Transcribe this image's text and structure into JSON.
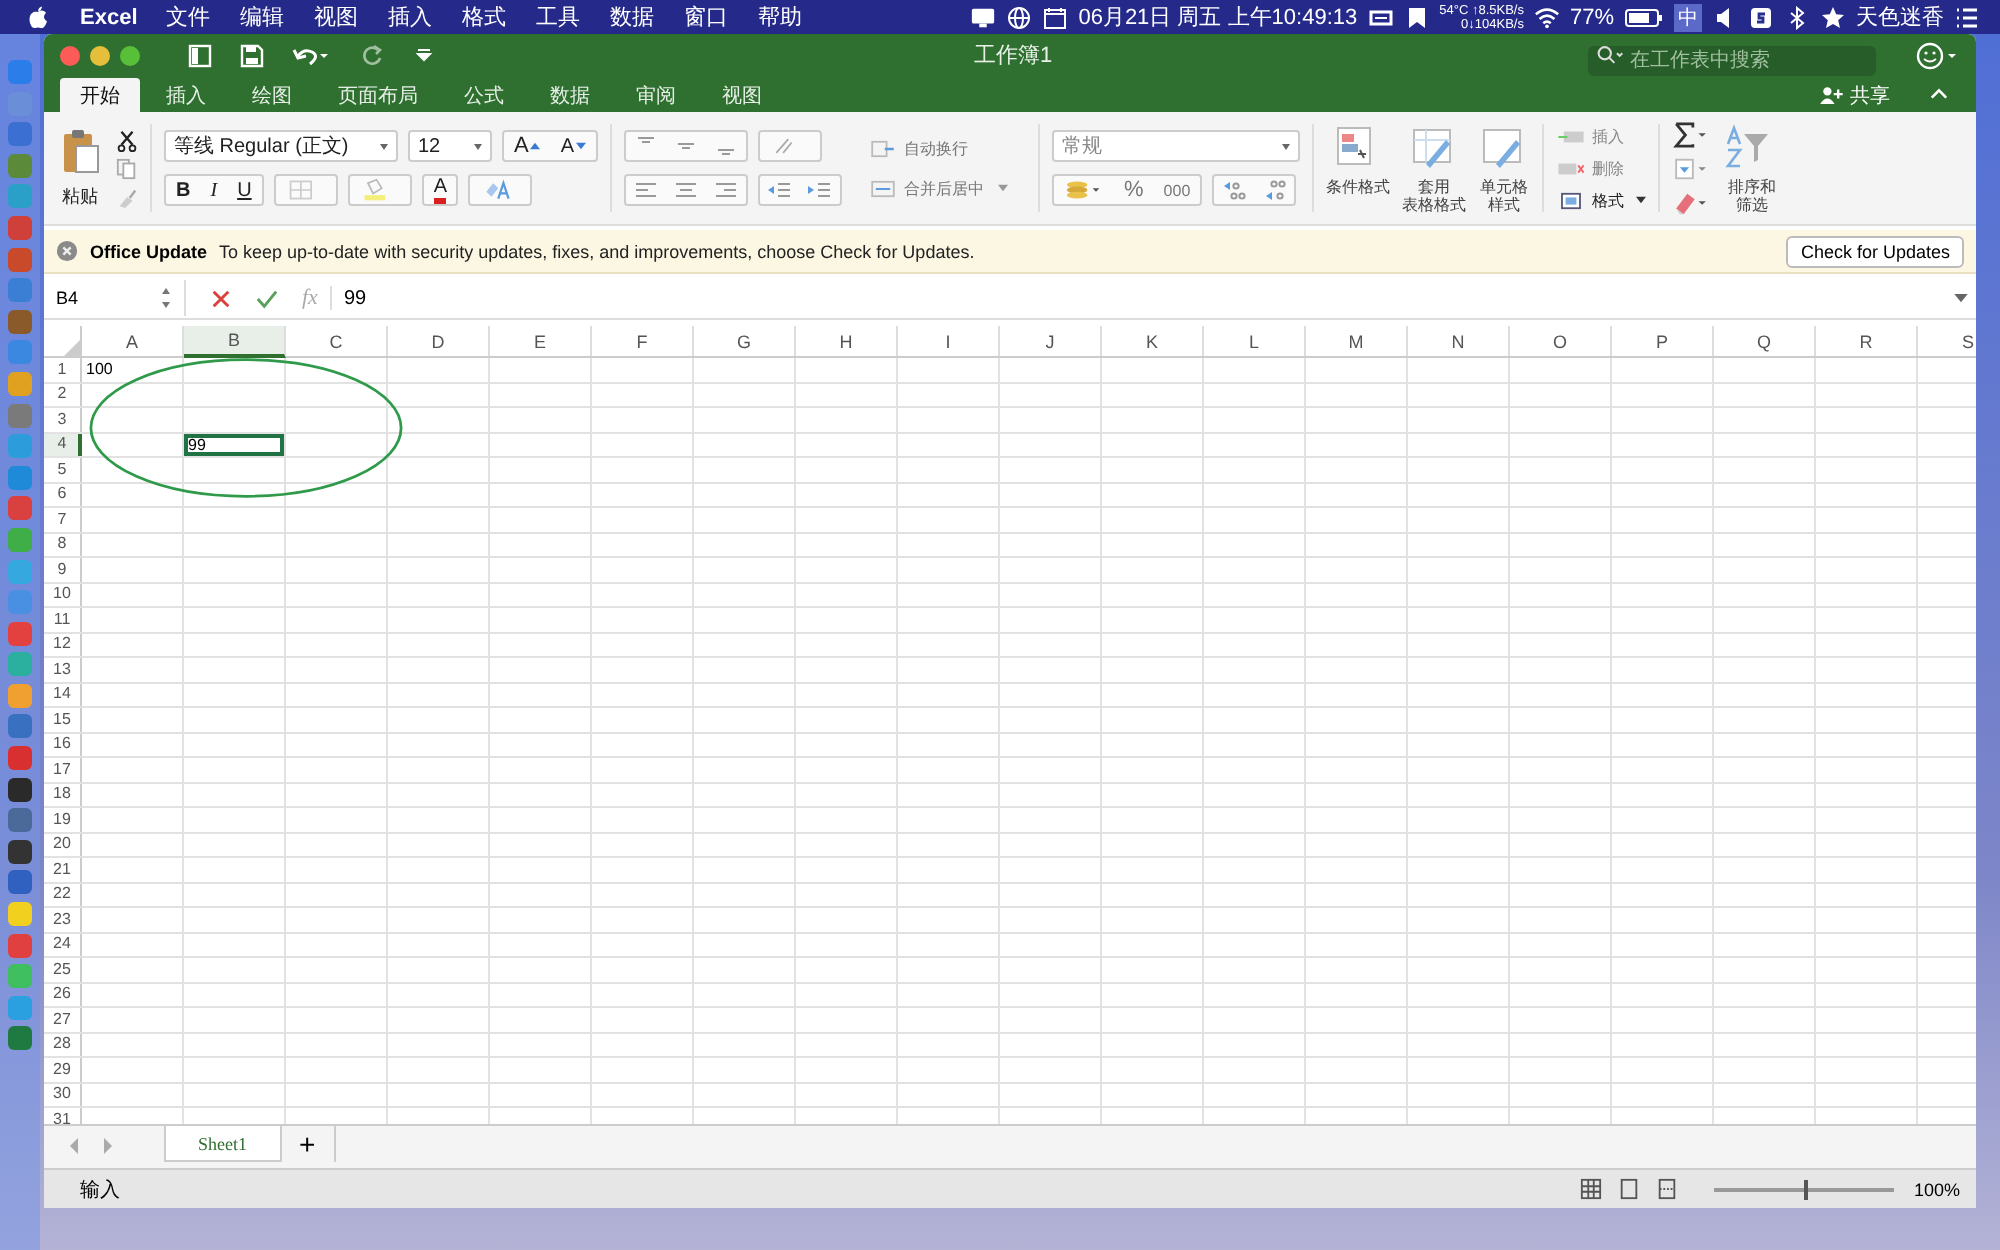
{
  "menubar": {
    "app": "Excel",
    "menus": [
      "文件",
      "编辑",
      "视图",
      "插入",
      "格式",
      "工具",
      "数据",
      "窗口",
      "帮助"
    ],
    "datetime": "06月21日 周五 上午10:49:13",
    "temperature": "54°C",
    "upload": "↑8.5KB/s",
    "download": "0↓104KB/s",
    "battery": "77%",
    "input_method": "中",
    "user": "天色迷香"
  },
  "window": {
    "title": "工作簿1",
    "search": {
      "placeholder": "在工作表中搜索"
    },
    "share": "共享"
  },
  "tabs": [
    {
      "label": "开始",
      "selected": true
    },
    {
      "label": "插入",
      "selected": false
    },
    {
      "label": "绘图",
      "selected": false
    },
    {
      "label": "页面布局",
      "selected": false
    },
    {
      "label": "公式",
      "selected": false
    },
    {
      "label": "数据",
      "selected": false
    },
    {
      "label": "审阅",
      "selected": false
    },
    {
      "label": "视图",
      "selected": false
    }
  ],
  "ribbon": {
    "paste": "粘贴",
    "font": "等线 Regular (正文)",
    "size": "12",
    "grow": "A",
    "shrink": "A",
    "bold": "B",
    "italic": "I",
    "underline": "U",
    "font_color": "A",
    "wrap": "自动换行",
    "merge": "合并后居中",
    "number_format": "常规",
    "percent": "%",
    "thousands": "000",
    "conditional": [
      "条件格式"
    ],
    "table_format": [
      "套用",
      "表格格式"
    ],
    "cell_style": [
      "单元格",
      "样式"
    ],
    "insert": "插入",
    "delete": "删除",
    "format": "格式",
    "sort": [
      "排序和",
      "筛选"
    ]
  },
  "update_bar": {
    "title": "Office Update",
    "message": "To keep up-to-date with security updates, fixes, and improvements, choose Check for Updates.",
    "button": "Check for Updates"
  },
  "formula_bar": {
    "name_box": "B4",
    "fx": "fx",
    "value": "99"
  },
  "columns": [
    {
      "label": "A",
      "selected": false
    },
    {
      "label": "B",
      "selected": true
    },
    {
      "label": "C",
      "selected": false
    },
    {
      "label": "D",
      "selected": false
    },
    {
      "label": "E",
      "selected": false
    },
    {
      "label": "F",
      "selected": false
    },
    {
      "label": "G",
      "selected": false
    },
    {
      "label": "H",
      "selected": false
    },
    {
      "label": "I",
      "selected": false
    },
    {
      "label": "J",
      "selected": false
    },
    {
      "label": "K",
      "selected": false
    },
    {
      "label": "L",
      "selected": false
    },
    {
      "label": "M",
      "selected": false
    },
    {
      "label": "N",
      "selected": false
    },
    {
      "label": "O",
      "selected": false
    },
    {
      "label": "P",
      "selected": false
    },
    {
      "label": "Q",
      "selected": false
    },
    {
      "label": "R",
      "selected": false
    },
    {
      "label": "S",
      "selected": false
    }
  ],
  "rows": [
    {
      "label": "1",
      "selected": false,
      "cells": [
        {
          "value": "100",
          "selected": false
        }
      ]
    },
    {
      "label": "2",
      "selected": false
    },
    {
      "label": "3",
      "selected": false
    },
    {
      "label": "4",
      "selected": true,
      "cells": [
        {},
        {
          "value": "99",
          "selected": true
        }
      ]
    },
    {
      "label": "5",
      "selected": false
    },
    {
      "label": "6",
      "selected": false
    },
    {
      "label": "7",
      "selected": false
    },
    {
      "label": "8",
      "selected": false
    },
    {
      "label": "9",
      "selected": false
    },
    {
      "label": "10",
      "selected": false
    },
    {
      "label": "11",
      "selected": false
    },
    {
      "label": "12",
      "selected": false
    },
    {
      "label": "13",
      "selected": false
    },
    {
      "label": "14",
      "selected": false
    },
    {
      "label": "15",
      "selected": false
    },
    {
      "label": "16",
      "selected": false
    },
    {
      "label": "17",
      "selected": false
    },
    {
      "label": "18",
      "selected": false
    },
    {
      "label": "19",
      "selected": false
    },
    {
      "label": "20",
      "selected": false
    },
    {
      "label": "21",
      "selected": false
    },
    {
      "label": "22",
      "selected": false
    },
    {
      "label": "23",
      "selected": false
    },
    {
      "label": "24",
      "selected": false
    },
    {
      "label": "25",
      "selected": false
    },
    {
      "label": "26",
      "selected": false
    },
    {
      "label": "27",
      "selected": false
    },
    {
      "label": "28",
      "selected": false
    },
    {
      "label": "29",
      "selected": false
    },
    {
      "label": "30",
      "selected": false
    },
    {
      "label": "31",
      "selected": false
    }
  ],
  "sheets": [
    {
      "label": "Sheet1",
      "selected": true
    }
  ],
  "add_sheet": "+",
  "status_bar": {
    "mode": "输入",
    "zoom": "100%",
    "zoom_slider": {
      "level": 0.5
    }
  }
}
